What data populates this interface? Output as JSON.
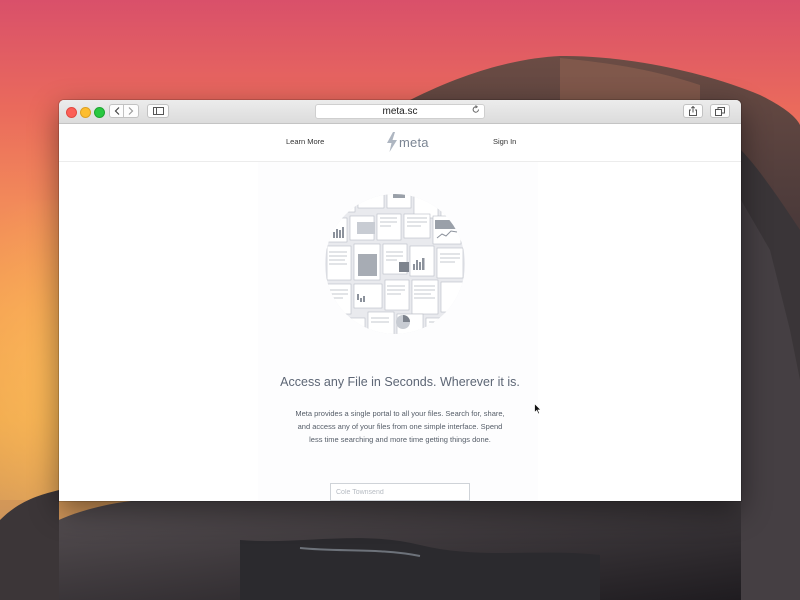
{
  "browser": {
    "url": "meta.sc"
  },
  "site": {
    "nav": {
      "learn_more": "Learn More",
      "sign_in": "Sign In"
    },
    "logo_text": "meta",
    "headline": "Access any File in Seconds. Wherever it is.",
    "description": "Meta provides a single portal to all your files. Search for, share, and access any of your files from one simple interface. Spend less time searching and more time getting things done.",
    "name_input": {
      "placeholder": "Cole Townsend",
      "value": ""
    }
  },
  "icons": {
    "back": "chevron-left-icon",
    "forward": "chevron-right-icon",
    "sidebar": "sidebar-icon",
    "reload": "reload-icon",
    "share": "share-icon",
    "tabs": "tabs-icon",
    "logo": "lightning-bolt-icon"
  },
  "colors": {
    "close": "#fc5f57",
    "minimize": "#fdbd2e",
    "zoom": "#28c840",
    "logo_gray": "#7b8593",
    "headline_gray": "#5d6675"
  }
}
